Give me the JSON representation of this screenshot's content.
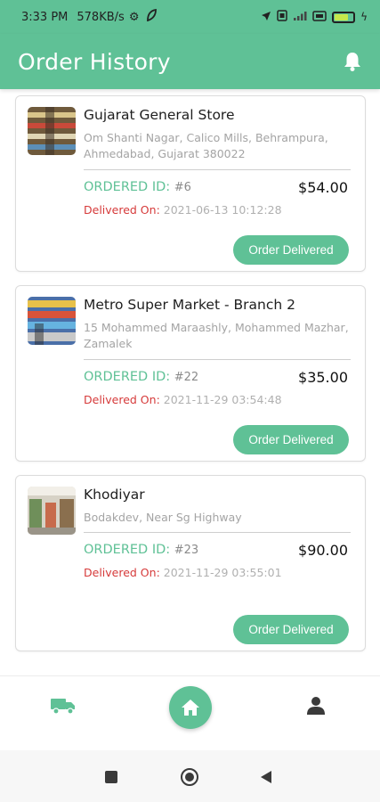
{
  "status_bar": {
    "time": "3:33 PM",
    "network_speed": "578KB/s",
    "icons": [
      "gear-icon",
      "leaf-icon",
      "location-arrow-icon",
      "sim-icon",
      "signal-icon",
      "wifi-icon",
      "battery-icon",
      "charging-icon"
    ]
  },
  "app_bar": {
    "title": "Order History",
    "action_icon": "bell-icon"
  },
  "colors": {
    "accent": "#5fc196",
    "delivered_label": "#d63a3a",
    "muted_text": "#a4a4a4"
  },
  "labels": {
    "ordered_id": "ORDERED ID:",
    "delivered_on": "Delivered On:"
  },
  "orders": [
    {
      "store_name": "Gujarat General Store",
      "address": "Om Shanti Nagar, Calico Mills, Behrampura, Ahmedabad, Gujarat 380022",
      "order_id": "#6",
      "price": "$54.00",
      "delivered_date": "2021-06-13 10:12:28",
      "status": "Order Delivered"
    },
    {
      "store_name": "Metro Super Market - Branch 2",
      "address": "15 Mohammed Maraashly, Mohammed Mazhar, Zamalek",
      "order_id": "#22",
      "price": "$35.00",
      "delivered_date": "2021-11-29 03:54:48",
      "status": "Order Delivered"
    },
    {
      "store_name": "Khodiyar",
      "address": "Bodakdev, Near Sg Highway",
      "order_id": "#23",
      "price": "$90.00",
      "delivered_date": "2021-11-29 03:55:01",
      "status": "Order Delivered"
    }
  ],
  "bottom_nav": {
    "items": [
      "truck-icon",
      "home-icon",
      "user-icon"
    ],
    "active": "home-icon"
  },
  "system_nav": [
    "recent-apps-button",
    "home-button",
    "back-button"
  ]
}
